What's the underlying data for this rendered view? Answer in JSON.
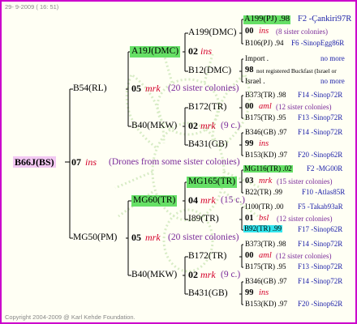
{
  "header": {
    "date": "29- 9-2009 ( 16: 51)"
  },
  "footer": {
    "copyright": "Copyright 2004-2009 @ Karl Kehde Foundation."
  },
  "root": {
    "id": "B66J(BS)",
    "gen": "07",
    "mark": "ins",
    "note": "(Drones from some sister colonies)"
  },
  "gen1": {
    "a": {
      "id": "B54(RL)"
    },
    "b": {
      "id": "MG50(PM)"
    }
  },
  "gen2": {
    "a": {
      "gen": "05",
      "mark": "mrk",
      "note": "(20 sister colonies)"
    },
    "b": {
      "gen": "05",
      "mark": "mrk",
      "note": "(20 sister colonies)"
    }
  },
  "gen3": {
    "aa": {
      "id": "A19J(DMC)"
    },
    "ab": {
      "id": "B40(MKW)"
    },
    "ba": {
      "id": "MG60(TR)"
    },
    "bb": {
      "id": "B40(MKW)"
    }
  },
  "gen4": {
    "aa": {
      "gen": "02",
      "mark": "ins"
    },
    "ab": {
      "gen": "02",
      "mark": "mrk",
      "note": "(9 c.)"
    },
    "ba": {
      "gen": "04",
      "mark": "mrk",
      "note": "(15 c.)"
    },
    "bb": {
      "gen": "02",
      "mark": "mrk",
      "note": "(9 c.)"
    }
  },
  "gen5": [
    {
      "id": "A199(DMC)"
    },
    {
      "id": "B12(DMC)"
    },
    {
      "id": "B172(TR)"
    },
    {
      "id": "B431(GB)"
    },
    {
      "id": "MG165(TR)"
    },
    {
      "id": "I89(TR)"
    },
    {
      "id": "B172(TR)"
    },
    {
      "id": "B431(GB)"
    }
  ],
  "gen6": [
    {
      "a": "A199(PJ) .98",
      "b": "F2 -Çankiri97R",
      "n": "00",
      "m": "ins",
      "note": "(8 sister colonies)",
      "c": "B106(PJ) .94",
      "d": "F6 -SinopEgg86R"
    },
    {
      "a": "Import .",
      "b": "no more",
      "n": "98",
      "m": "",
      "note": "not registered Buckfast (Israel or",
      "c": "Israel .",
      "d": "no more"
    },
    {
      "a": "B373(TR) .98",
      "b": "F14 -Sinop72R",
      "n": "00",
      "m": "aml",
      "note": "(12 sister colonies)",
      "c": "B175(TR) .95",
      "d": "F13 -Sinop72R"
    },
    {
      "a": "B346(GB) .97",
      "b": "F14 -Sinop72R",
      "n": "99",
      "m": "ins",
      "note": "",
      "c": "B153(KD) .97",
      "d": "F20 -Sinop62R"
    },
    {
      "a": "MG116(TR) .02",
      "b": "F2 -MG00R",
      "n": "03",
      "m": "mrk",
      "note": "(15 sister colonies)",
      "c": "B22(TR) .99",
      "d": "F10 -Atlas85R"
    },
    {
      "a": "I100(TR) .00",
      "b": "F5 -Takab93aR",
      "n": "01",
      "m": "bsl",
      "note": "(12 sister colonies)",
      "c": "B92(TR) .99",
      "d": "F17 -Sinop62R"
    },
    {
      "a": "B373(TR) .98",
      "b": "F14 -Sinop72R",
      "n": "00",
      "m": "aml",
      "note": "(12 sister colonies)",
      "c": "B175(TR) .95",
      "d": "F13 -Sinop72R"
    },
    {
      "a": "B346(GB) .97",
      "b": "F14 -Sinop72R",
      "n": "99",
      "m": "ins",
      "note": "",
      "c": "B153(KD) .97",
      "d": "F20 -Sinop62R"
    }
  ]
}
